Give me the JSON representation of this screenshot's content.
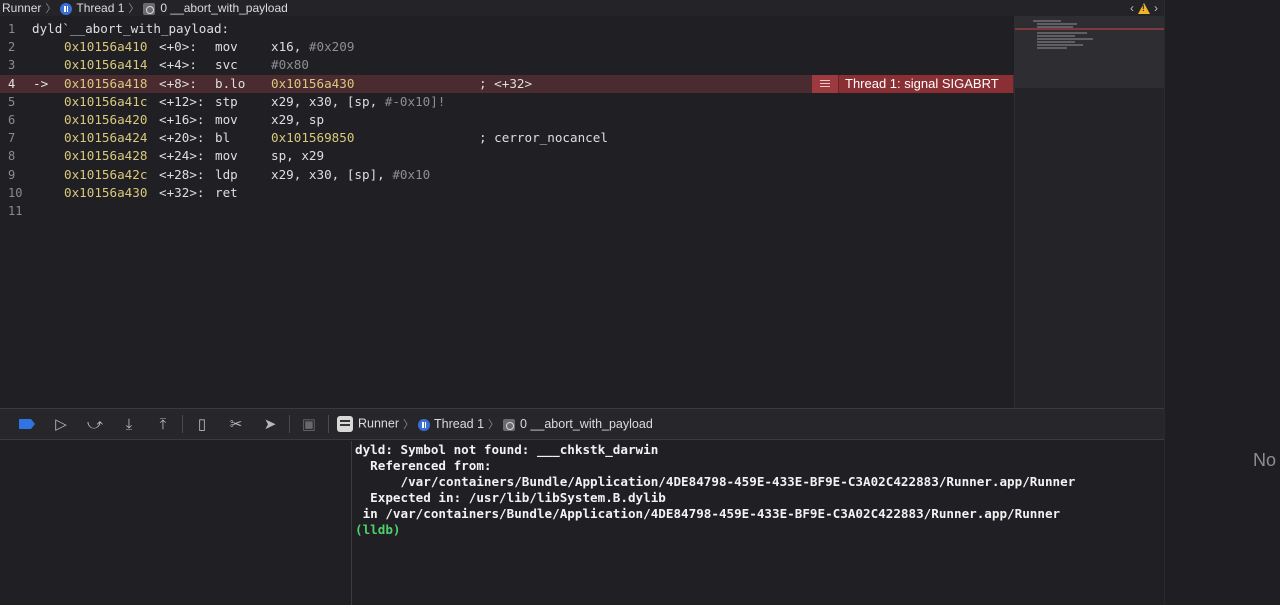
{
  "jumpbar": {
    "app": "Runner",
    "thread": "Thread 1",
    "frame": "0 __abort_with_payload"
  },
  "editor": {
    "lines": [
      {
        "n": "1",
        "label": "dyld`__abort_with_payload:"
      },
      {
        "n": "2",
        "addr": "0x10156a410",
        "off": "<+0>:",
        "mn": "mov",
        "ops": "x16, ",
        "imm": "#0x209"
      },
      {
        "n": "3",
        "addr": "0x10156a414",
        "off": "<+4>:",
        "mn": "svc",
        "imm": "#0x80"
      },
      {
        "n": "4",
        "arrow": "->",
        "addr": "0x10156a418",
        "off": "<+8>:",
        "mn": "b.lo",
        "addrop": "0x10156a430",
        "cmt": "; <+32>"
      },
      {
        "n": "5",
        "addr": "0x10156a41c",
        "off": "<+12>:",
        "mn": "stp",
        "ops": "x29, x30, [sp, ",
        "imm": "#-0x10]!"
      },
      {
        "n": "6",
        "addr": "0x10156a420",
        "off": "<+16>:",
        "mn": "mov",
        "ops": "x29, sp"
      },
      {
        "n": "7",
        "addr": "0x10156a424",
        "off": "<+20>:",
        "mn": "bl",
        "addrop": "0x101569850",
        "cmt": "; cerror_nocancel"
      },
      {
        "n": "8",
        "addr": "0x10156a428",
        "off": "<+24>:",
        "mn": "mov",
        "ops": "sp, x29"
      },
      {
        "n": "9",
        "addr": "0x10156a42c",
        "off": "<+28>:",
        "mn": "ldp",
        "ops": "x29, x30, [sp], ",
        "imm": "#0x10"
      },
      {
        "n": "10",
        "addr": "0x10156a430",
        "off": "<+32>:",
        "mn": "ret"
      },
      {
        "n": "11"
      }
    ],
    "issue": "Thread 1: signal SIGABRT"
  },
  "debugbar": {
    "app": "Runner",
    "thread": "Thread 1",
    "frame": "0 __abort_with_payload"
  },
  "console": {
    "lines": [
      "dyld: Symbol not found: ___chkstk_darwin",
      "  Referenced from:",
      "      /var/containers/Bundle/Application/4DE84798-459E-433E-BF9E-C3A02C422883/Runner.app/Runner",
      "  Expected in: /usr/lib/libSystem.B.dylib",
      " in /var/containers/Bundle/Application/4DE84798-459E-433E-BF9E-C3A02C422883/Runner.app/Runner"
    ],
    "prompt": "(lldb)"
  },
  "right_pane": {
    "text": "No"
  },
  "colors": {
    "current_line": "#4a2b30",
    "issue_badge": "#8a2f34",
    "address": "#d9c97c",
    "prompt": "#4fd06a",
    "breakpoint": "#2f74e0"
  }
}
